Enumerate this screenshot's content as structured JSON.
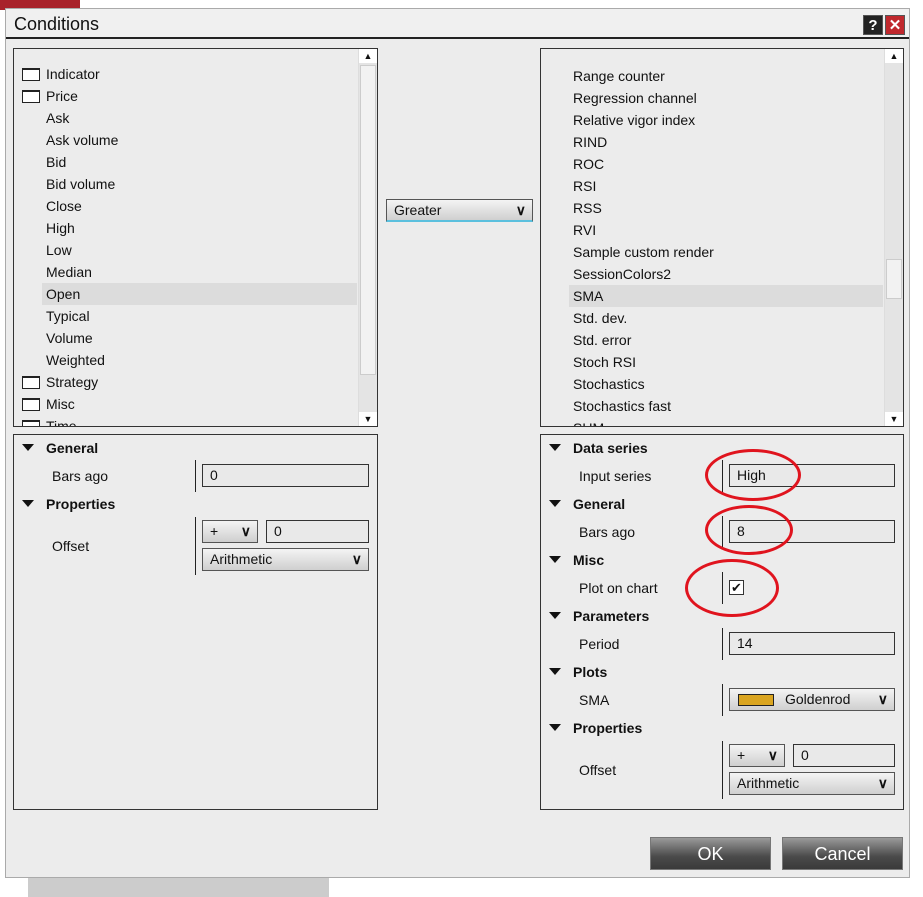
{
  "dialog": {
    "title": "Conditions",
    "help_label": "?",
    "close_label": "✕"
  },
  "left_list": {
    "items": [
      {
        "label": "Indicator",
        "type": "folder"
      },
      {
        "label": "Price",
        "type": "folder-open"
      },
      {
        "label": "Ask",
        "type": "child"
      },
      {
        "label": "Ask volume",
        "type": "child"
      },
      {
        "label": "Bid",
        "type": "child"
      },
      {
        "label": "Bid volume",
        "type": "child"
      },
      {
        "label": "Close",
        "type": "child"
      },
      {
        "label": "High",
        "type": "child"
      },
      {
        "label": "Low",
        "type": "child"
      },
      {
        "label": "Median",
        "type": "child"
      },
      {
        "label": "Open",
        "type": "child",
        "selected": true
      },
      {
        "label": "Typical",
        "type": "child"
      },
      {
        "label": "Volume",
        "type": "child"
      },
      {
        "label": "Weighted",
        "type": "child"
      },
      {
        "label": "Strategy",
        "type": "folder"
      },
      {
        "label": "Misc",
        "type": "folder"
      },
      {
        "label": "Time",
        "type": "folder"
      }
    ]
  },
  "operator": {
    "selected": "Greater"
  },
  "right_list": {
    "items": [
      "Range counter",
      "Regression channel",
      "Relative vigor index",
      "RIND",
      "ROC",
      "RSI",
      "RSS",
      "RVI",
      "Sample custom render",
      "SessionColors2",
      "SMA",
      "Std. dev.",
      "Std. error",
      "Stoch RSI",
      "Stochastics",
      "Stochastics fast",
      "SUM"
    ],
    "selected": "SMA"
  },
  "left_props": {
    "general": "General",
    "bars_ago_label": "Bars ago",
    "bars_ago": "0",
    "properties": "Properties",
    "offset_label": "Offset",
    "offset_sign": "+",
    "offset_value": "0",
    "offset_type": "Arithmetic"
  },
  "right_props": {
    "data_series": "Data series",
    "input_series_label": "Input series",
    "input_series": "High",
    "general": "General",
    "bars_ago_label": "Bars ago",
    "bars_ago": "8",
    "misc": "Misc",
    "plot_on_chart_label": "Plot on chart",
    "plot_on_chart": true,
    "parameters": "Parameters",
    "period_label": "Period",
    "period": "14",
    "plots": "Plots",
    "sma_label": "SMA",
    "sma_color_name": "Goldenrod",
    "sma_color": "#daa520",
    "properties": "Properties",
    "offset_label": "Offset",
    "offset_sign": "+",
    "offset_value": "0",
    "offset_type": "Arithmetic"
  },
  "buttons": {
    "ok": "OK",
    "cancel": "Cancel"
  },
  "colors": {
    "annotation": "#e0141e",
    "close_button": "#c0282d"
  }
}
